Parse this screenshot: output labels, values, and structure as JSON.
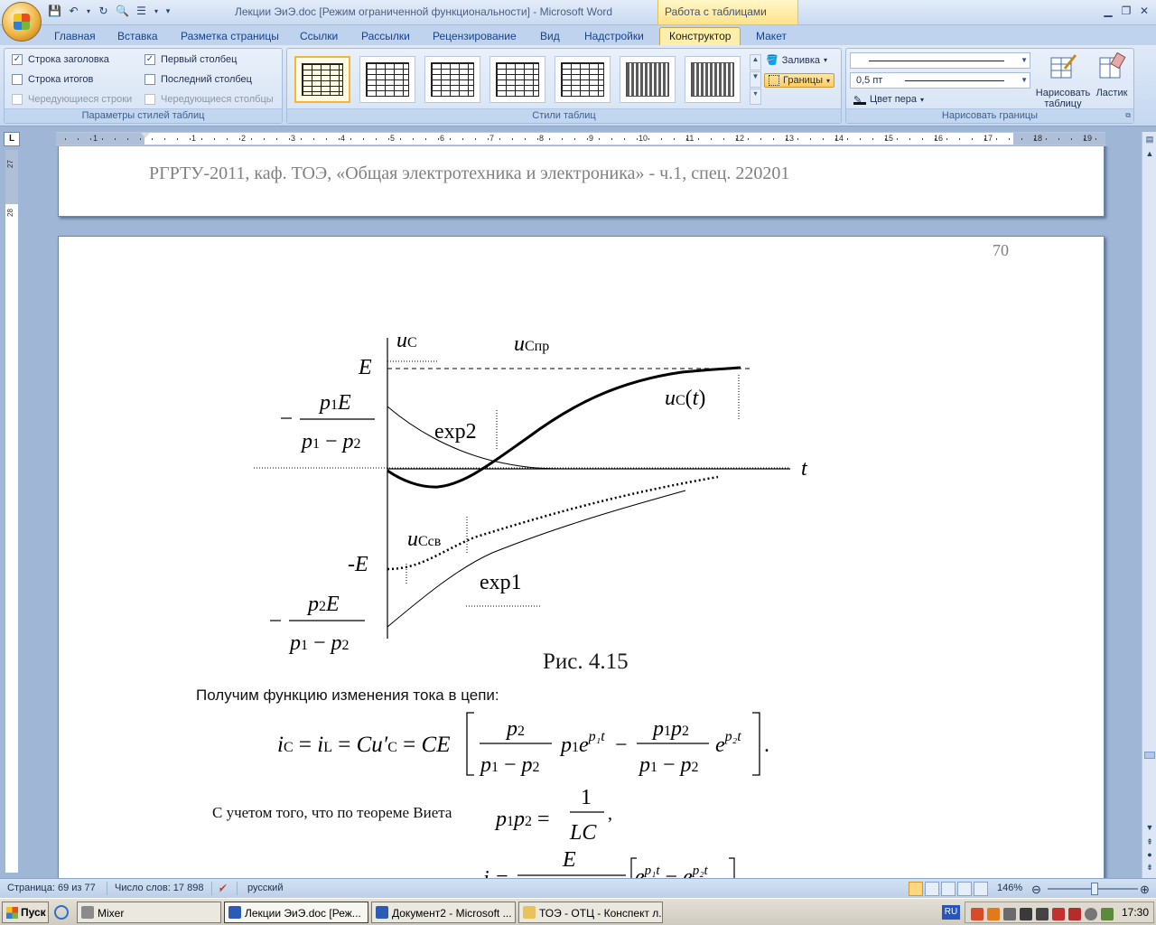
{
  "app": {
    "window_title": "Лекции ЭиЭ.doc [Режим ограниченной функциональности] - Microsoft Word",
    "context_tab_title": "Работа с таблицами"
  },
  "ribbon": {
    "tabs": [
      "Главная",
      "Вставка",
      "Разметка страницы",
      "Ссылки",
      "Рассылки",
      "Рецензирование",
      "Вид",
      "Надстройки",
      "Конструктор",
      "Макет"
    ],
    "active_tab": "Конструктор",
    "style_options": {
      "label": "Параметры стилей таблиц",
      "header_row": "Строка заголовка",
      "total_row": "Строка итогов",
      "banded_rows": "Чередующиеся строки",
      "first_column": "Первый столбец",
      "last_column": "Последний столбец",
      "banded_columns": "Чередующиеся столбцы"
    },
    "table_styles_label": "Стили таблиц",
    "shading": "Заливка",
    "borders": "Границы",
    "draw_borders": {
      "label": "Нарисовать границы",
      "line_weight": "0,5 пт",
      "pen_color": "Цвет пера",
      "draw_table": "Нарисовать таблицу",
      "eraser": "Ластик"
    }
  },
  "ruler": {
    "h_numbers": [
      "1",
      "1",
      "2",
      "3",
      "4",
      "5",
      "6",
      "7",
      "8",
      "9",
      "10",
      "11",
      "12",
      "13",
      "14",
      "15",
      "16",
      "17",
      "18",
      "19"
    ],
    "v_numbers": [
      "27",
      "28"
    ]
  },
  "document": {
    "header_text": "РГРТУ-2011, каф. ТОЭ, «Общая электротехника и электроника» - ч.1, спец. 220201",
    "page_number": "70",
    "caption": "Рис. 4.15",
    "paragraph1": "Получим функцию изменения тока в цепи:",
    "paragraph2": "С учетом того, что по теореме Виета"
  },
  "statusbar": {
    "page": "Страница: 69 из 77",
    "words": "Число слов: 17 898",
    "language": "русский",
    "zoom": "146%"
  },
  "taskbar": {
    "start": "Пуск",
    "tasks": [
      "Mixer",
      "Лекции ЭиЭ.doc [Реж...",
      "Документ2 - Microsoft ...",
      "ТОЭ - ОТЦ - Конспект л..."
    ],
    "lang": "RU",
    "clock": "17:30"
  }
}
